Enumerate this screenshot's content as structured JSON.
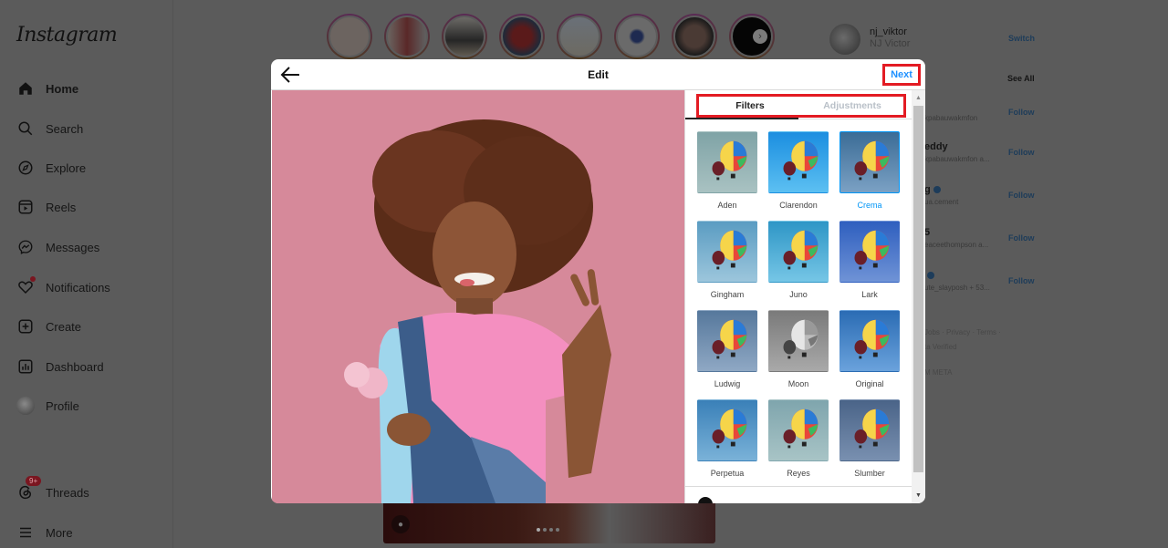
{
  "sidebar": {
    "logo": "Instagram",
    "items": [
      {
        "label": "Home",
        "icon": "home-icon",
        "active": true
      },
      {
        "label": "Search",
        "icon": "search-icon"
      },
      {
        "label": "Explore",
        "icon": "compass-icon"
      },
      {
        "label": "Reels",
        "icon": "reels-icon"
      },
      {
        "label": "Messages",
        "icon": "messenger-icon"
      },
      {
        "label": "Notifications",
        "icon": "heart-icon"
      },
      {
        "label": "Create",
        "icon": "plus-square-icon"
      },
      {
        "label": "Dashboard",
        "icon": "chart-icon"
      },
      {
        "label": "Profile",
        "icon": "avatar-icon"
      },
      {
        "label": "Threads",
        "icon": "threads-icon",
        "badge": "9+"
      },
      {
        "label": "More",
        "icon": "menu-icon"
      }
    ]
  },
  "stories": {
    "count": 8,
    "next_icon": "chevron-right-icon"
  },
  "right_column": {
    "username": "nj_viktor",
    "full_name": "NJ Victor",
    "switch_label": "Switch",
    "see_all_label": "See All",
    "suggestions": [
      {
        "name": "",
        "sub": "kpabauwakmfon",
        "action": "Follow"
      },
      {
        "name": "eddy",
        "sub": "kpabauwakmfon a...",
        "action": "Follow"
      },
      {
        "name": "g",
        "sub": "ua.cement",
        "action": "Follow",
        "verified": true
      },
      {
        "name": "5",
        "sub": "eaceethompson a...",
        "action": "Follow"
      },
      {
        "name": "",
        "sub": "ute_slayposh + 53...",
        "action": "Follow",
        "verified": true
      }
    ],
    "footer": [
      "Jobs · Privacy · Terms ·",
      "ta Verified",
      "M META"
    ]
  },
  "modal": {
    "title": "Edit",
    "back_icon": "arrow-left-icon",
    "next_label": "Next",
    "tabs": [
      {
        "label": "Filters",
        "active": true
      },
      {
        "label": "Adjustments",
        "active": false
      }
    ],
    "filters": [
      {
        "label": "Aden",
        "bg": [
          "#7fa3a6",
          "#a9c2c2"
        ]
      },
      {
        "label": "Clarendon",
        "bg": [
          "#1b8ee0",
          "#5cc0f2"
        ]
      },
      {
        "label": "Crema",
        "bg": [
          "#3b6c96",
          "#7ba1c4"
        ],
        "selected": true
      },
      {
        "label": "Gingham",
        "bg": [
          "#5a9cc2",
          "#9cc6dc"
        ]
      },
      {
        "label": "Juno",
        "bg": [
          "#2e96c6",
          "#76c6e6"
        ]
      },
      {
        "label": "Lark",
        "bg": [
          "#2f5fbf",
          "#6f93d6"
        ]
      },
      {
        "label": "Ludwig",
        "bg": [
          "#56789c",
          "#8fa8c4"
        ]
      },
      {
        "label": "Moon",
        "bg": [
          "#7a7a7a",
          "#a9a9a9"
        ],
        "grayscale": true
      },
      {
        "label": "Original",
        "bg": [
          "#2b6cb4",
          "#6aa2dc"
        ]
      },
      {
        "label": "Perpetua",
        "bg": [
          "#3a80b8",
          "#7ab2d8"
        ]
      },
      {
        "label": "Reyes",
        "bg": [
          "#7fa5ad",
          "#a8c4c6"
        ]
      },
      {
        "label": "Slumber",
        "bg": [
          "#4a6488",
          "#7990b0"
        ]
      }
    ],
    "selected_filter": "Crema"
  },
  "colors": {
    "accent": "#0095f6",
    "highlight_box": "#e31b23",
    "overlay_bg": "#5b5b5b"
  }
}
